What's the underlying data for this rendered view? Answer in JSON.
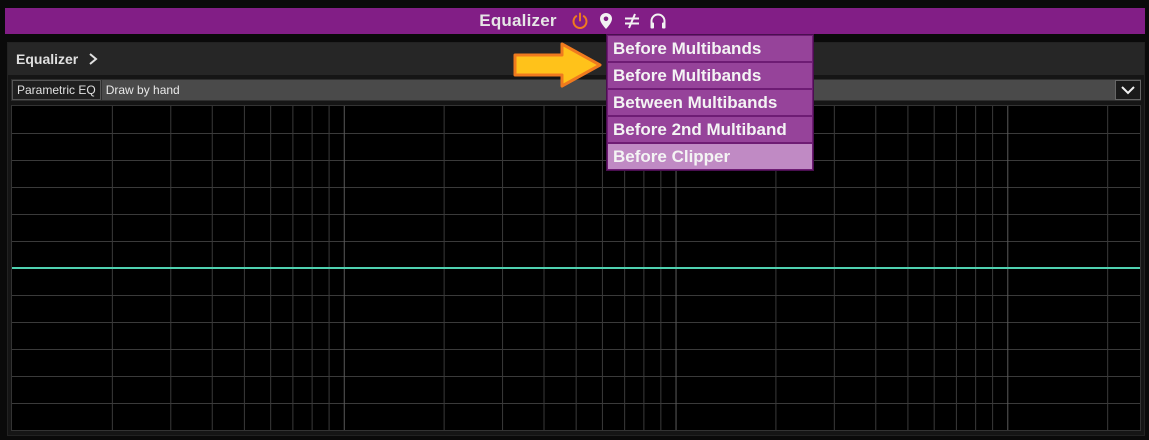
{
  "titlebar": {
    "title": "Equalizer",
    "icons": [
      "power-icon",
      "location-pin-icon",
      "not-equal-icon",
      "headphones-icon"
    ],
    "accent": "#821e86",
    "power_color": "#f07a1e"
  },
  "panel": {
    "header_label": "Equalizer",
    "header_chevron": "chevron-right-icon"
  },
  "modebar": {
    "mode_button": "Parametric EQ",
    "mode_value": "Draw by hand",
    "dropdown_icon": "chevron-down-icon"
  },
  "dropdown_menu": {
    "items": [
      "Before Multibands",
      "Before Multibands",
      "Between Multibands",
      "Before 2nd Multiband",
      "Before Clipper"
    ],
    "selected_index": 4,
    "bg_color": "#96439a",
    "selected_color": "#c08ac4"
  },
  "graph": {
    "curve_color": "#4fd1b0",
    "grid_color": "#3a3a3a",
    "major_grid_color": "#5a5a5a"
  },
  "callout": {
    "arrow_icon": "arrow-right-icon",
    "fill": "#ffc21a",
    "stroke": "#f07a1e"
  }
}
